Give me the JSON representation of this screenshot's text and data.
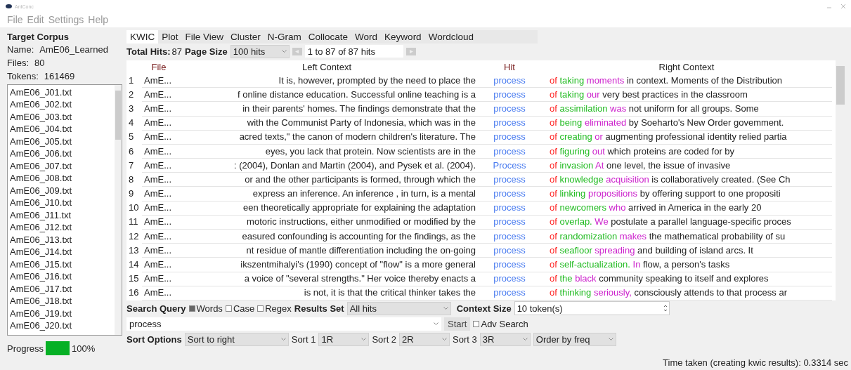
{
  "window": {
    "title": "AntConc"
  },
  "menu": [
    "File",
    "Edit",
    "Settings",
    "Help"
  ],
  "corpus": {
    "heading": "Target Corpus",
    "name_label": "Name:",
    "name": "AmE06_Learned",
    "files_label": "Files:",
    "files": "80",
    "tokens_label": "Tokens:",
    "tokens": "161469",
    "files_list": [
      "AmE06_J01.txt",
      "AmE06_J02.txt",
      "AmE06_J03.txt",
      "AmE06_J04.txt",
      "AmE06_J05.txt",
      "AmE06_J06.txt",
      "AmE06_J07.txt",
      "AmE06_J08.txt",
      "AmE06_J09.txt",
      "AmE06_J10.txt",
      "AmE06_J11.txt",
      "AmE06_J12.txt",
      "AmE06_J13.txt",
      "AmE06_J14.txt",
      "AmE06_J15.txt",
      "AmE06_J16.txt",
      "AmE06_J17.txt",
      "AmE06_J18.txt",
      "AmE06_J19.txt",
      "AmE06_J20.txt"
    ]
  },
  "progress": {
    "label": "Progress",
    "level": 1,
    "reading": "100%"
  },
  "tabs": [
    {
      "label": "KWIC",
      "selected": true
    },
    {
      "label": "Plot",
      "selected": false
    },
    {
      "label": "File View",
      "selected": false
    },
    {
      "label": "Cluster",
      "selected": false
    },
    {
      "label": "N-Gram",
      "selected": false
    },
    {
      "label": "Collocate",
      "selected": false
    },
    {
      "label": "Word",
      "selected": false
    },
    {
      "label": "Keyword",
      "selected": false
    },
    {
      "label": "Wordcloud",
      "selected": false
    }
  ],
  "hits_bar": {
    "total_label": "Total Hits:",
    "total": "87",
    "page_size_label": "Page Size",
    "page_size": "100 hits",
    "range": "1 to 87 of 87 hits"
  },
  "table": {
    "columns": [
      "File",
      "Left Context",
      "Hit",
      "Right Context"
    ],
    "rows": [
      {
        "n": "1",
        "file": "AmE...",
        "left": "It is, however, prompted by the need to place the",
        "hit": "process",
        "right": [
          "of",
          "taking",
          "moments",
          "in context. Moments of the Distribution"
        ]
      },
      {
        "n": "2",
        "file": "AmE...",
        "left": "f online distance education. Successful online teaching is a",
        "hit": "process",
        "right": [
          "of",
          "taking",
          "our",
          "very best practices in the classroom"
        ]
      },
      {
        "n": "3",
        "file": "AmE...",
        "left": "in their parents' homes. The findings demonstrate that the",
        "hit": "process",
        "right": [
          "of",
          "assimilation",
          "was",
          "not uniform for all groups. Some"
        ]
      },
      {
        "n": "4",
        "file": "AmE...",
        "left": "with the Communist Party of Indonesia, which was in the",
        "hit": "process",
        "right": [
          "of",
          "being",
          "eliminated",
          "by Soeharto's New Order govemment."
        ]
      },
      {
        "n": "5",
        "file": "AmE...",
        "left": "acred texts,\" the canon of modern children's literature. The",
        "hit": "process",
        "right": [
          "of",
          "creating",
          "or",
          "augmenting professional identity relied partia"
        ]
      },
      {
        "n": "6",
        "file": "AmE...",
        "left": "eyes, you lack that protein. Now scientists are in the",
        "hit": "process",
        "right": [
          "of",
          "figuring",
          "out",
          "which proteins are coded for by"
        ]
      },
      {
        "n": "7",
        "file": "AmE...",
        "left": ": (2004), Donlan and Martin (2004), and Pysek et al. (2004).",
        "hit": "Process",
        "right": [
          "of",
          "invasion",
          "At",
          "one level, the issue of invasive"
        ]
      },
      {
        "n": "8",
        "file": "AmE...",
        "left": "or and the other participants is formed, through which the",
        "hit": "process",
        "right": [
          "of",
          "knowledge",
          "acquisition",
          "is collaboratively created. (See Ch"
        ]
      },
      {
        "n": "9",
        "file": "AmE...",
        "left": "express an inference. An inference , in turn, is a mental",
        "hit": "process",
        "right": [
          "of",
          "linking",
          "propositions",
          "by offering support to one propositi"
        ]
      },
      {
        "n": "10",
        "file": "AmE...",
        "left": "een theoretically appropriate for explaining the adaptation",
        "hit": "process",
        "right": [
          "of",
          "newcomers",
          "who",
          "arrived in America in the early 20"
        ]
      },
      {
        "n": "11",
        "file": "AmE...",
        "left": "motoric instructions, either unmodified or modified by the",
        "hit": "process",
        "right": [
          "of",
          "overlap.",
          "We",
          "postulate a parallel language-specific proces"
        ]
      },
      {
        "n": "12",
        "file": "AmE...",
        "left": "easured confounding is accounting for the findings, as the",
        "hit": "process",
        "right": [
          "of",
          "randomization",
          "makes",
          "the mathematical probability of su"
        ]
      },
      {
        "n": "13",
        "file": "AmE...",
        "left": "nt residue of mantle differentiation including the on-going",
        "hit": "process",
        "right": [
          "of",
          "seafloor",
          "spreading",
          "and building of island arcs. It"
        ]
      },
      {
        "n": "14",
        "file": "AmE...",
        "left": "ikszentmihalyi's (1990) concept of \"flow\" is a more general",
        "hit": "process",
        "right": [
          "of",
          "self-actualization.",
          "In",
          "flow, a person's tasks"
        ]
      },
      {
        "n": "15",
        "file": "AmE...",
        "left": "a voice of \"several strengths.\" Her voice thereby enacts a",
        "hit": "process",
        "right": [
          "of",
          "the",
          "black",
          "community speaking to itself and explores"
        ]
      },
      {
        "n": "16",
        "file": "AmE...",
        "left": "is not, it is that the critical thinker takes the",
        "hit": "process",
        "right": [
          "of",
          "thinking",
          "seriously,",
          "consciously attends to that process ar"
        ]
      }
    ]
  },
  "search": {
    "label": "Search Query",
    "options": [
      {
        "label": "Words",
        "checked": true
      },
      {
        "label": "Case",
        "checked": false
      },
      {
        "label": "Regex",
        "checked": false
      }
    ],
    "results_label": "Results Set",
    "results": "All hits",
    "context_label": "Context Size",
    "context": "10 token(s)",
    "query": "process",
    "start": "Start",
    "adv": {
      "label": "Adv Search",
      "checked": false
    }
  },
  "sort": {
    "label": "Sort Options",
    "mode": "Sort to right",
    "levels": [
      {
        "label": "Sort 1",
        "value": "1R"
      },
      {
        "label": "Sort 2",
        "value": "2R"
      },
      {
        "label": "Sort 3",
        "value": "3R"
      }
    ],
    "order": "Order by freq"
  },
  "status": "Time taken (creating kwic results):  0.3314 sec"
}
